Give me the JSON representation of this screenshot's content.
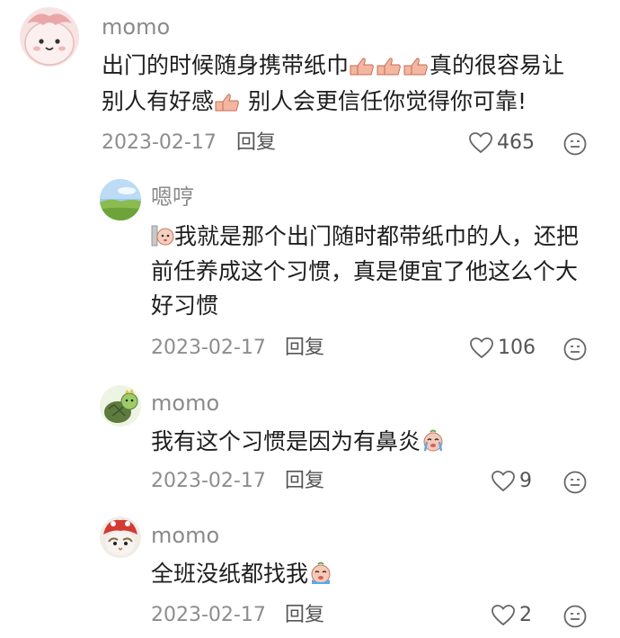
{
  "comments": [
    {
      "username": "momo",
      "text_line1_a": "出门的时候随身携带纸巾",
      "text_line1_b": "真的很容易让",
      "text_line2_a": "别人有好感",
      "text_line2_b": " 别人会更信任你觉得你可靠!",
      "date": "2023-02-17",
      "reply_label": "回复",
      "like_count": "465",
      "emoji": "thumbs-up-emoji"
    },
    {
      "username": "嗯哼",
      "text_line1": "我就是那个出门随时都带纸巾的人，还把",
      "text_line2": "前任养成这个习惯，真是便宜了他这么个大",
      "text_line3": "好习惯",
      "date": "2023-02-17",
      "reply_label": "回复",
      "like_count": "106",
      "emoji": "face-emoji"
    },
    {
      "username": "momo",
      "text": "我有这个习惯是因为有鼻炎",
      "date": "2023-02-17",
      "reply_label": "回复",
      "like_count": "9",
      "emoji": "crying-face-emoji"
    },
    {
      "username": "momo",
      "text": "全班没纸都找我",
      "date": "2023-02-17",
      "reply_label": "回复",
      "like_count": "2",
      "emoji": "crying-face-emoji"
    }
  ],
  "colors": {
    "username": "#8a8a8a",
    "text": "#1e1e1e",
    "meta": "#8d8d8d",
    "icon": "#6a6a6a"
  }
}
